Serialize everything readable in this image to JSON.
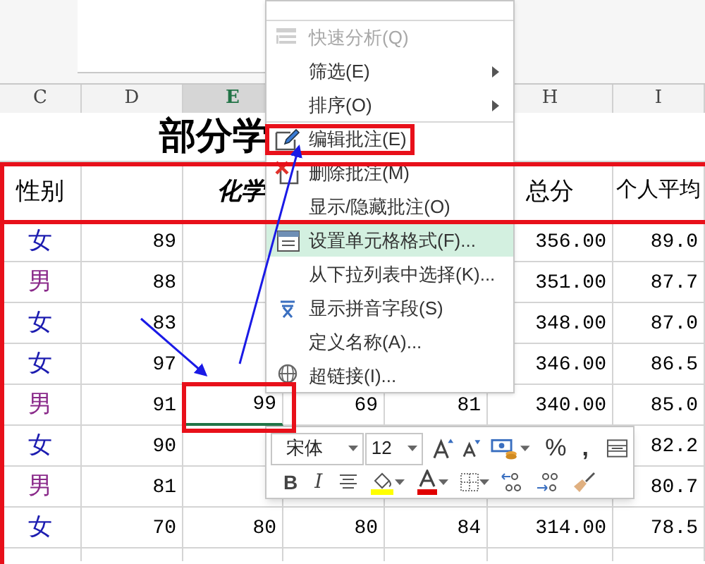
{
  "columns": {
    "c": {
      "label": "C",
      "selected": false
    },
    "d": {
      "label": "D",
      "selected": false
    },
    "e": {
      "label": "E",
      "selected": true
    },
    "h": {
      "label": "H",
      "selected": false
    },
    "i": {
      "label": "I",
      "selected": false
    }
  },
  "title": "部分学",
  "header": {
    "c": "性别",
    "e": "化学",
    "h": "总分",
    "i": "个人平均"
  },
  "rows": [
    {
      "color": "#1c1cb0",
      "selected": false,
      "c": "女",
      "d": "89",
      "h": "356.00",
      "i": "89.0"
    },
    {
      "color": "#8a2a8a",
      "selected": false,
      "c": "男",
      "d": "88",
      "h": "351.00",
      "i": "87.7"
    },
    {
      "color": "#1c1cb0",
      "selected": false,
      "c": "女",
      "d": "83",
      "h": "348.00",
      "i": "87.0"
    },
    {
      "color": "#1c1cb0",
      "selected": false,
      "c": "女",
      "d": "97",
      "h": "346.00",
      "i": "86.5"
    },
    {
      "color": "#8a2a8a",
      "selected": true,
      "c": "男",
      "d": "91",
      "e": "99",
      "f": "69",
      "g": "81",
      "h": "340.00",
      "i": "85.0"
    },
    {
      "color": "#1c1cb0",
      "selected": false,
      "c": "女",
      "d": "90",
      "i": "82.2"
    },
    {
      "color": "#8a2a8a",
      "selected": false,
      "c": "男",
      "d": "81",
      "i": "80.7"
    },
    {
      "color": "#1c1cb0",
      "selected": false,
      "c": "女",
      "d": "70",
      "e": "80",
      "f": "80",
      "g": "84",
      "h": "314.00",
      "i": "78.5"
    }
  ],
  "menu": [
    {
      "label": "快速分析(Q)",
      "disabled": true,
      "selected": false,
      "submenu": false,
      "separator_before": true
    },
    {
      "label": "筛选(E)",
      "disabled": false,
      "selected": false,
      "submenu": true,
      "separator_before": false
    },
    {
      "label": "排序(O)",
      "disabled": false,
      "selected": false,
      "submenu": true,
      "separator_before": false
    },
    {
      "label": "编辑批注(E)",
      "disabled": false,
      "selected": false,
      "submenu": false,
      "separator_before": true
    },
    {
      "label": "删除批注(M)",
      "disabled": false,
      "selected": false,
      "submenu": false,
      "separator_before": false
    },
    {
      "label": "显示/隐藏批注(O)",
      "disabled": false,
      "selected": false,
      "submenu": false,
      "separator_before": false
    },
    {
      "label": "设置单元格格式(F)...",
      "disabled": false,
      "selected": true,
      "submenu": false,
      "separator_before": true
    },
    {
      "label": "从下拉列表中选择(K)...",
      "disabled": false,
      "selected": false,
      "submenu": false,
      "separator_before": false
    },
    {
      "label": "显示拼音字段(S)",
      "disabled": false,
      "selected": false,
      "submenu": false,
      "separator_before": false
    },
    {
      "label": "定义名称(A)...",
      "disabled": false,
      "selected": false,
      "submenu": false,
      "separator_before": false
    },
    {
      "label": "超链接(I)...",
      "disabled": false,
      "selected": false,
      "submenu": false,
      "separator_before": false
    }
  ],
  "toolbar": {
    "font": "宋体",
    "size": "12",
    "percent_label": "%",
    "comma_label": ",",
    "bold_label": "B",
    "italic_label": "I"
  }
}
